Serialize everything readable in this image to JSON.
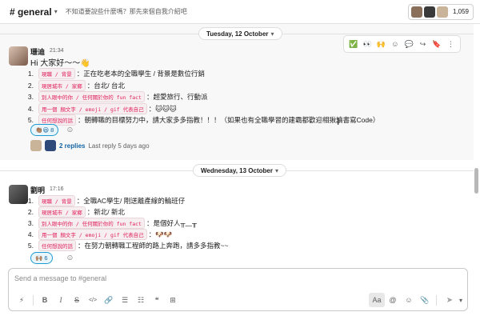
{
  "header": {
    "channel": "# general",
    "topic": "不知道要說些什麼嗎？那先來個自我介紹吧",
    "member_count": "1,059"
  },
  "dividers": [
    {
      "label": "Tuesday, 12 October"
    },
    {
      "label": "Wednesday, 13 October"
    }
  ],
  "toolbar": {
    "buttons": [
      "✅",
      "👀",
      "🙌",
      "☺",
      "💬",
      "↪",
      "🔖",
      "⋮"
    ]
  },
  "messages": [
    {
      "author": "珊迪",
      "time": "21:34",
      "greeting": "Hi 大家好～～👋",
      "items": [
        {
          "num": "1.",
          "code": "現職 / 背景",
          "text": "：正在吃老本的全職學生 / 背景是數位行銷"
        },
        {
          "num": "2.",
          "code": "現居城市 / 家鄉",
          "text": "：台北/ 台北"
        },
        {
          "num": "3.",
          "code": "別人眼中的你 / 任何關於你的 fun fact",
          "text": "：超愛旅行、行動派"
        },
        {
          "num": "4.",
          "code": "用一個 顏文字 / emoji / gif 代表自己",
          "text": "：🐱🐱🐱"
        },
        {
          "num": "5.",
          "code": "任何想說的話",
          "text": "：朝轉職的目標努力中，請大家多多指教！！！（如果也有全職學習的建霸都歡迎相揪讀書寫Code）"
        }
      ],
      "reaction": {
        "emoji": "👏🏽😃",
        "count": "8"
      },
      "replies": {
        "count_label": "2 replies",
        "meta": "Last reply 5 days ago"
      }
    },
    {
      "author": "劉明",
      "time": "17:16",
      "items": [
        {
          "num": "1.",
          "code": "現職 / 背景",
          "text": "：全職AC學生/ 剛送離產線的輪班仔"
        },
        {
          "num": "2.",
          "code": "現居城市 / 家鄉",
          "text": "：新北/ 新北"
        },
        {
          "num": "3.",
          "code": "別人眼中的你 / 任何關於你的 fun fact",
          "text": "：是個好人╥﹏╥"
        },
        {
          "num": "4.",
          "code": "用一個 顏文字 / emoji / gif 代表自己",
          "text": "：🐶🐶"
        },
        {
          "num": "5.",
          "code": "任何想說的話",
          "text": "：在努力朝轉職工程師的路上奔跑，請多多指教~~"
        }
      ],
      "reaction": {
        "emoji": "🙌🏽",
        "count": "6"
      }
    }
  ],
  "composer": {
    "placeholder": "Send a message to #general",
    "buttons": [
      "⚡",
      "B",
      "I",
      "S",
      "</>",
      "🔗",
      "☰",
      "☷",
      "❝",
      "⊞"
    ],
    "right_buttons": [
      "Aa",
      "@",
      "☺",
      "📎"
    ],
    "send": "➤"
  },
  "colors": {
    "link": "#1264a3",
    "code_text": "#e01e5a",
    "reaction_border": "#1d9bd1"
  }
}
